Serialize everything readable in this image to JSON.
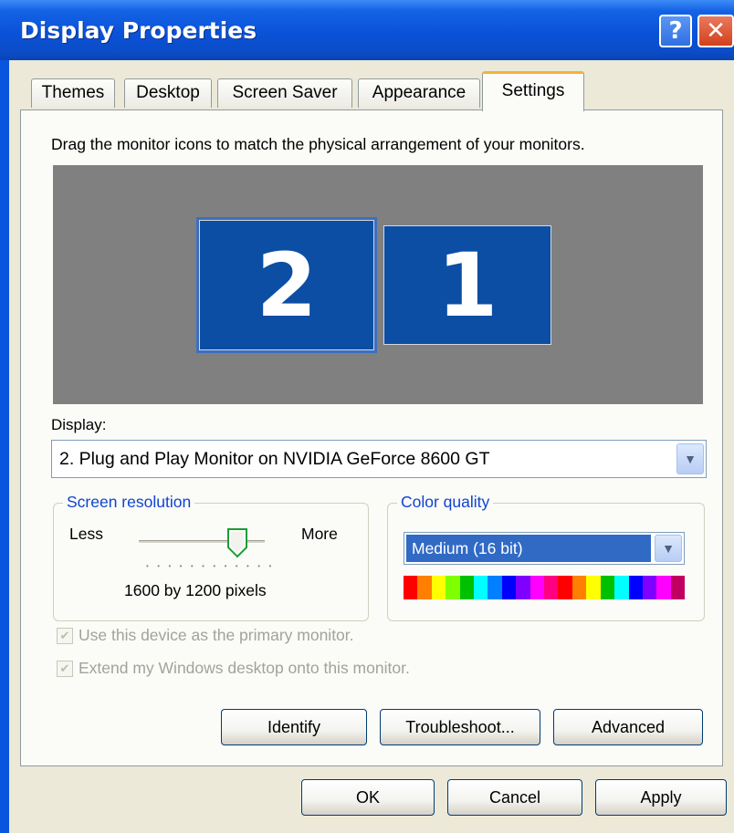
{
  "window": {
    "title": "Display Properties",
    "help_glyph": "?",
    "close_glyph": "✕"
  },
  "tabs": [
    {
      "label": "Themes"
    },
    {
      "label": "Desktop"
    },
    {
      "label": "Screen Saver"
    },
    {
      "label": "Appearance"
    },
    {
      "label": "Settings",
      "active": true
    }
  ],
  "settings": {
    "instruction": "Drag the monitor icons to match the physical arrangement of your monitors.",
    "monitors": [
      {
        "number": "2",
        "selected": true
      },
      {
        "number": "1",
        "selected": false
      }
    ],
    "display_label": "Display:",
    "display_value": "2. Plug and Play Monitor on NVIDIA GeForce 8600 GT",
    "screen_resolution": {
      "legend": "Screen resolution",
      "less_label": "Less",
      "more_label": "More",
      "value_text": "1600 by 1200 pixels",
      "slider_fraction": 0.8
    },
    "color_quality": {
      "legend": "Color quality",
      "selected": "Medium (16 bit)"
    },
    "checkboxes": [
      {
        "label": "Use this device as the primary monitor.",
        "checked": true,
        "disabled": true
      },
      {
        "label": "Extend my Windows desktop onto this monitor.",
        "checked": true,
        "disabled": true
      }
    ]
  },
  "buttons": {
    "identify": "Identify",
    "troubleshoot": "Troubleshoot...",
    "advanced": "Advanced",
    "ok": "OK",
    "cancel": "Cancel",
    "apply": "Apply"
  },
  "colors": {
    "titlebar": "#0a52d8",
    "dialog_bg": "#ece9d8",
    "monitor_area": "#808080",
    "monitor_fill": "#0c4ea4",
    "selection": "#316ac5",
    "group_legend": "#1044d0"
  },
  "icons": [
    "help-icon",
    "close-icon",
    "chevron-down-icon",
    "slider-thumb-icon",
    "checkmark-icon"
  ]
}
